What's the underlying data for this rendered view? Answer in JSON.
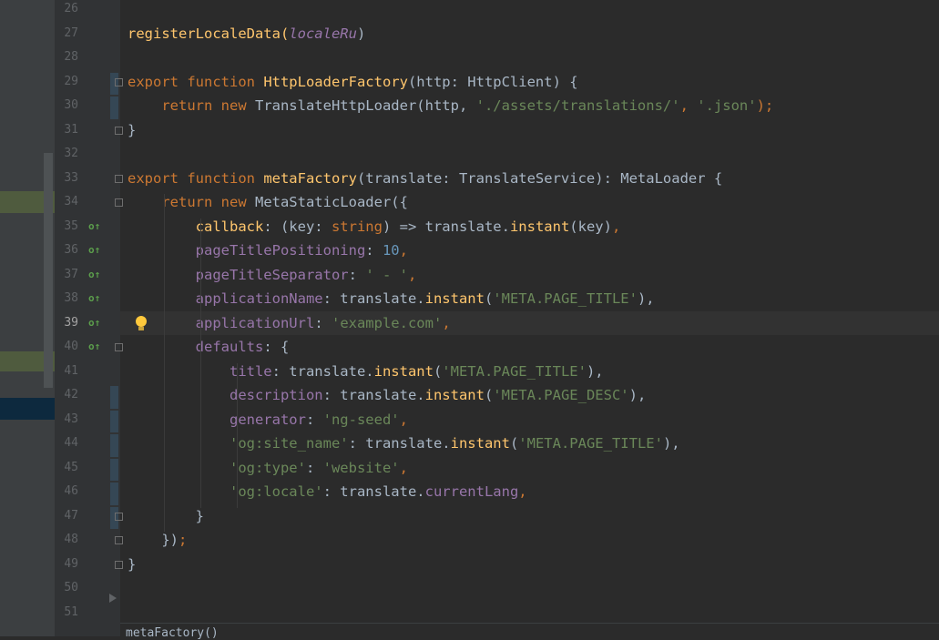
{
  "editor": {
    "lines": [
      {
        "num": "26",
        "tokens": []
      },
      {
        "num": "27",
        "tokens": [
          {
            "t": "registerLocaleData(",
            "c": "fn"
          },
          {
            "t": "localeRu",
            "c": "ital"
          },
          {
            "t": ")",
            "c": "plain"
          }
        ]
      },
      {
        "num": "28",
        "tokens": []
      },
      {
        "num": "29",
        "tokens": [
          {
            "t": "export function ",
            "c": "kw"
          },
          {
            "t": "HttpLoaderFactory",
            "c": "fn"
          },
          {
            "t": "(http: HttpClient) {",
            "c": "plain"
          }
        ]
      },
      {
        "num": "30",
        "tokens": [
          {
            "t": "    return new ",
            "c": "kw"
          },
          {
            "t": "TranslateHttpLoader(http, ",
            "c": "plain"
          },
          {
            "t": "'./assets/translations/'",
            "c": "str"
          },
          {
            "t": ", ",
            "c": "kw"
          },
          {
            "t": "'.json'",
            "c": "str"
          },
          {
            "t": ");",
            "c": "kw"
          }
        ]
      },
      {
        "num": "31",
        "tokens": [
          {
            "t": "}",
            "c": "plain"
          }
        ]
      },
      {
        "num": "32",
        "tokens": []
      },
      {
        "num": "33",
        "tokens": [
          {
            "t": "export function ",
            "c": "kw"
          },
          {
            "t": "metaFactory",
            "c": "fn"
          },
          {
            "t": "(translate: TranslateService): MetaLoader {",
            "c": "plain"
          }
        ]
      },
      {
        "num": "34",
        "tokens": [
          {
            "t": "    return new ",
            "c": "kw"
          },
          {
            "t": "MetaStaticLoader({",
            "c": "plain"
          }
        ]
      },
      {
        "num": "35",
        "tokens": [
          {
            "t": "        callback",
            "c": "fn"
          },
          {
            "t": ": (key: ",
            "c": "plain"
          },
          {
            "t": "string",
            "c": "kw"
          },
          {
            "t": ") => translate.",
            "c": "plain"
          },
          {
            "t": "instant",
            "c": "fn"
          },
          {
            "t": "(key)",
            "c": "plain"
          },
          {
            "t": ",",
            "c": "kw"
          }
        ]
      },
      {
        "num": "36",
        "tokens": [
          {
            "t": "        pageTitlePositioning",
            "c": "prop"
          },
          {
            "t": ": ",
            "c": "plain"
          },
          {
            "t": "10",
            "c": "num"
          },
          {
            "t": ",",
            "c": "kw"
          }
        ]
      },
      {
        "num": "37",
        "tokens": [
          {
            "t": "        pageTitleSeparator",
            "c": "prop"
          },
          {
            "t": ": ",
            "c": "plain"
          },
          {
            "t": "' - '",
            "c": "str"
          },
          {
            "t": ",",
            "c": "kw"
          }
        ]
      },
      {
        "num": "38",
        "tokens": [
          {
            "t": "        applicationName",
            "c": "prop"
          },
          {
            "t": ": translate.",
            "c": "plain"
          },
          {
            "t": "instant",
            "c": "fn"
          },
          {
            "t": "(",
            "c": "plain"
          },
          {
            "t": "'META.PAGE_TITLE'",
            "c": "str"
          },
          {
            "t": "),",
            "c": "plain"
          }
        ]
      },
      {
        "num": "39",
        "tokens": [
          {
            "t": "        applicationUrl",
            "c": "prop"
          },
          {
            "t": ": ",
            "c": "plain"
          },
          {
            "t": "'example.com'",
            "c": "str"
          },
          {
            "t": ",",
            "c": "kw"
          }
        ]
      },
      {
        "num": "40",
        "tokens": [
          {
            "t": "        defaults",
            "c": "prop"
          },
          {
            "t": ": {",
            "c": "plain"
          }
        ]
      },
      {
        "num": "41",
        "tokens": [
          {
            "t": "            title",
            "c": "prop"
          },
          {
            "t": ": translate.",
            "c": "plain"
          },
          {
            "t": "instant",
            "c": "fn"
          },
          {
            "t": "(",
            "c": "plain"
          },
          {
            "t": "'META.PAGE_TITLE'",
            "c": "str"
          },
          {
            "t": "),",
            "c": "plain"
          }
        ]
      },
      {
        "num": "42",
        "tokens": [
          {
            "t": "            description",
            "c": "prop"
          },
          {
            "t": ": translate.",
            "c": "plain"
          },
          {
            "t": "instant",
            "c": "fn"
          },
          {
            "t": "(",
            "c": "plain"
          },
          {
            "t": "'META.PAGE_DESC'",
            "c": "str"
          },
          {
            "t": "),",
            "c": "plain"
          }
        ]
      },
      {
        "num": "43",
        "tokens": [
          {
            "t": "            generator",
            "c": "prop"
          },
          {
            "t": ": ",
            "c": "plain"
          },
          {
            "t": "'ng-seed'",
            "c": "str"
          },
          {
            "t": ",",
            "c": "kw"
          }
        ]
      },
      {
        "num": "44",
        "tokens": [
          {
            "t": "            'og:site_name'",
            "c": "str"
          },
          {
            "t": ": translate.",
            "c": "plain"
          },
          {
            "t": "instant",
            "c": "fn"
          },
          {
            "t": "(",
            "c": "plain"
          },
          {
            "t": "'META.PAGE_TITLE'",
            "c": "str"
          },
          {
            "t": "),",
            "c": "plain"
          }
        ]
      },
      {
        "num": "45",
        "tokens": [
          {
            "t": "            'og:type'",
            "c": "str"
          },
          {
            "t": ": ",
            "c": "plain"
          },
          {
            "t": "'website'",
            "c": "str"
          },
          {
            "t": ",",
            "c": "kw"
          }
        ]
      },
      {
        "num": "46",
        "tokens": [
          {
            "t": "            'og:locale'",
            "c": "str"
          },
          {
            "t": ": translate.",
            "c": "plain"
          },
          {
            "t": "currentLang",
            "c": "prop"
          },
          {
            "t": ",",
            "c": "kw"
          }
        ]
      },
      {
        "num": "47",
        "tokens": [
          {
            "t": "        }",
            "c": "plain"
          }
        ]
      },
      {
        "num": "48",
        "tokens": [
          {
            "t": "    })",
            "c": "plain"
          },
          {
            "t": ";",
            "c": "kw"
          }
        ]
      },
      {
        "num": "49",
        "tokens": [
          {
            "t": "}",
            "c": "plain"
          }
        ]
      },
      {
        "num": "50",
        "tokens": []
      },
      {
        "num": "51",
        "tokens": []
      }
    ],
    "current_line": "39",
    "bottom_text": "metaFactory()"
  },
  "colors": {
    "keyword": "#cc7832",
    "function": "#ffc66d",
    "string": "#6a8759",
    "number": "#6897bb",
    "property": "#9876aa",
    "text": "#a9b7c6",
    "background": "#2b2b2b"
  }
}
